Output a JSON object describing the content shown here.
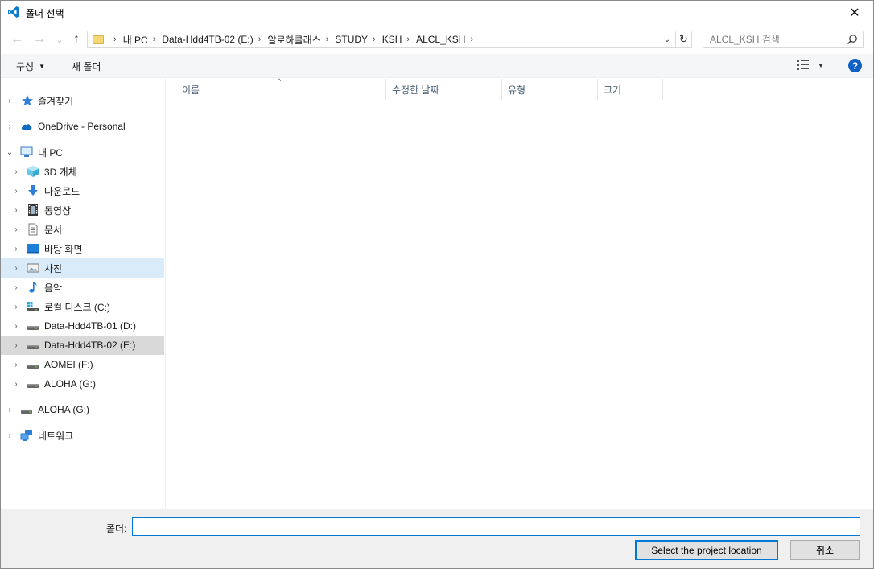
{
  "window": {
    "title": "폴더 선택",
    "close_label": "✕"
  },
  "nav": {
    "back_label": "←",
    "forward_label": "→",
    "recent_label": "⌄",
    "up_label": "↑",
    "breadcrumb": [
      "내 PC",
      "Data-Hdd4TB-02 (E:)",
      "알로하클래스",
      "STUDY",
      "KSH",
      "ALCL_KSH"
    ],
    "dropdown_label": "⌄",
    "refresh_label": "↻",
    "search_placeholder": "ALCL_KSH 검색"
  },
  "toolbar": {
    "organize_label": "구성",
    "new_folder_label": "새 폴더",
    "help_label": "?"
  },
  "sidebar": {
    "items": [
      {
        "label": "즐겨찾기",
        "icon": "star-icon"
      },
      {
        "label": "OneDrive - Personal",
        "icon": "cloud-icon"
      },
      {
        "label": "내 PC",
        "icon": "computer-icon"
      },
      {
        "label": "3D 개체",
        "icon": "cube-icon"
      },
      {
        "label": "다운로드",
        "icon": "download-icon"
      },
      {
        "label": "동영상",
        "icon": "film-icon"
      },
      {
        "label": "문서",
        "icon": "document-icon"
      },
      {
        "label": "바탕 화면",
        "icon": "desktop-icon"
      },
      {
        "label": "사진",
        "icon": "picture-icon"
      },
      {
        "label": "음악",
        "icon": "music-icon"
      },
      {
        "label": "로컬 디스크 (C:)",
        "icon": "system-drive-icon"
      },
      {
        "label": "Data-Hdd4TB-01 (D:)",
        "icon": "drive-icon"
      },
      {
        "label": "Data-Hdd4TB-02 (E:)",
        "icon": "drive-icon"
      },
      {
        "label": "AOMEI (F:)",
        "icon": "drive-icon"
      },
      {
        "label": "ALOHA (G:)",
        "icon": "drive-icon"
      },
      {
        "label": "ALOHA (G:)",
        "icon": "drive-icon"
      },
      {
        "label": "네트워크",
        "icon": "network-icon"
      }
    ]
  },
  "columns": [
    "이름",
    "수정한 날짜",
    "유형",
    "크기"
  ],
  "footer": {
    "folder_label": "폴더:",
    "folder_value": "",
    "select_button": "Select the project location",
    "cancel_button": "취소"
  },
  "colors": {
    "accent": "#0078d7",
    "selected_bg": "#d9ebf9",
    "active_bg": "#d9d9d9",
    "help": "#1060c8"
  }
}
